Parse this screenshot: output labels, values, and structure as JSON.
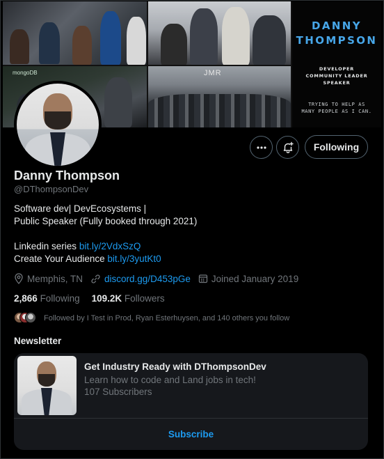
{
  "banner": {
    "brand_name_line1": "DANNY",
    "brand_name_line2": "THOMPSON",
    "role_line1": "DEVELOPER",
    "role_line2": "COMMUNITY LEADER",
    "role_line3": "SPEAKER",
    "tagline_line1": "TRYING TO HELP AS",
    "tagline_line2": "MANY PEOPLE AS I CAN.",
    "photo_sign_1": "mongoDB",
    "photo_sign_2": "JMR"
  },
  "actions": {
    "more_icon": "more-horizontal-icon",
    "notify_icon": "bell-plus-icon",
    "follow_label": "Following"
  },
  "profile": {
    "name": "Danny Thompson",
    "handle": "@DThompsonDev",
    "bio_line1": "Software dev| DevEcosystems |",
    "bio_line2": "Public Speaker (Fully booked through 2021)",
    "linkedin_label": "Linkedin series",
    "linkedin_link": "bit.ly/2VdxSzQ",
    "audience_label": "Create Your Audience",
    "audience_link": "bit.ly/3yutKt0",
    "location": "Memphis, TN",
    "website": "discord.gg/D453pGe",
    "joined": "Joined January 2019",
    "following_count": "2,866",
    "following_label": "Following",
    "followers_count": "109.2K",
    "followers_label": "Followers",
    "followed_by": "Followed by I Test in Prod, Ryan Esterhuysen, and 140 others you follow"
  },
  "newsletter": {
    "section_title": "Newsletter",
    "title": "Get Industry Ready with DThompsonDev",
    "description": "Learn how to code and Land jobs in tech!",
    "subscribers": "107 Subscribers",
    "subscribe_label": "Subscribe"
  },
  "colors": {
    "background": "#000000",
    "accent": "#1d9bf0",
    "muted_text": "#71767b",
    "brand_blue": "#47a6e8"
  }
}
